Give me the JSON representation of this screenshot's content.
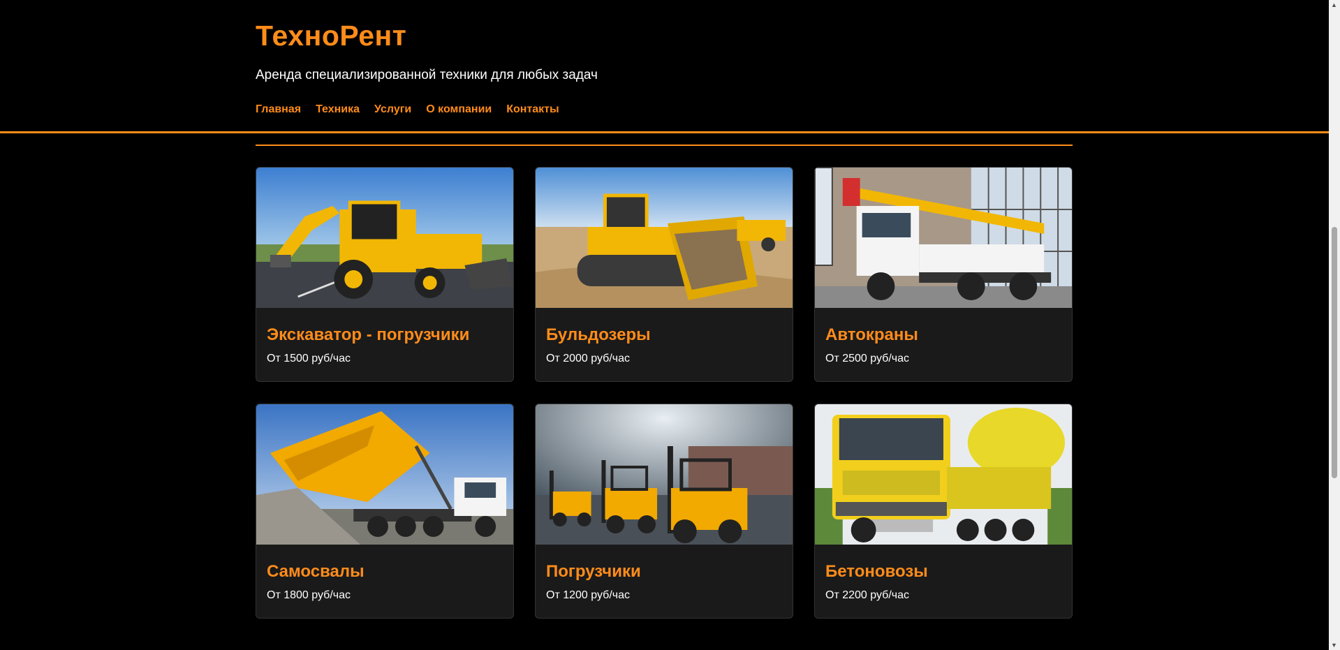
{
  "header": {
    "logo": "ТехноРент",
    "tagline": "Аренда специализированной техники для любых задач",
    "nav": [
      "Главная",
      "Техника",
      "Услуги",
      "О компании",
      "Контакты"
    ]
  },
  "colors": {
    "accent": "#ff8c1a",
    "background": "#000000",
    "card": "#1a1a1a"
  },
  "cards": [
    {
      "title": "Экскаватор - погрузчики",
      "price": "От 1500 руб/час",
      "image": "yellow-backhoe-loader-photo"
    },
    {
      "title": "Бульдозеры",
      "price": "От 2000 руб/час",
      "image": "yellow-bulldozer-photo"
    },
    {
      "title": "Автокраны",
      "price": "От 2500 руб/час",
      "image": "truck-crane-ivanovets-photo"
    },
    {
      "title": "Самосвалы",
      "price": "От 1800 руб/час",
      "image": "dump-truck-unloading-gravel-photo"
    },
    {
      "title": "Погрузчики",
      "price": "От 1200 руб/час",
      "image": "yellow-forklifts-photo"
    },
    {
      "title": "Бетоновозы",
      "price": "От 2200 руб/час",
      "image": "concrete-mixer-truck-photo"
    }
  ]
}
